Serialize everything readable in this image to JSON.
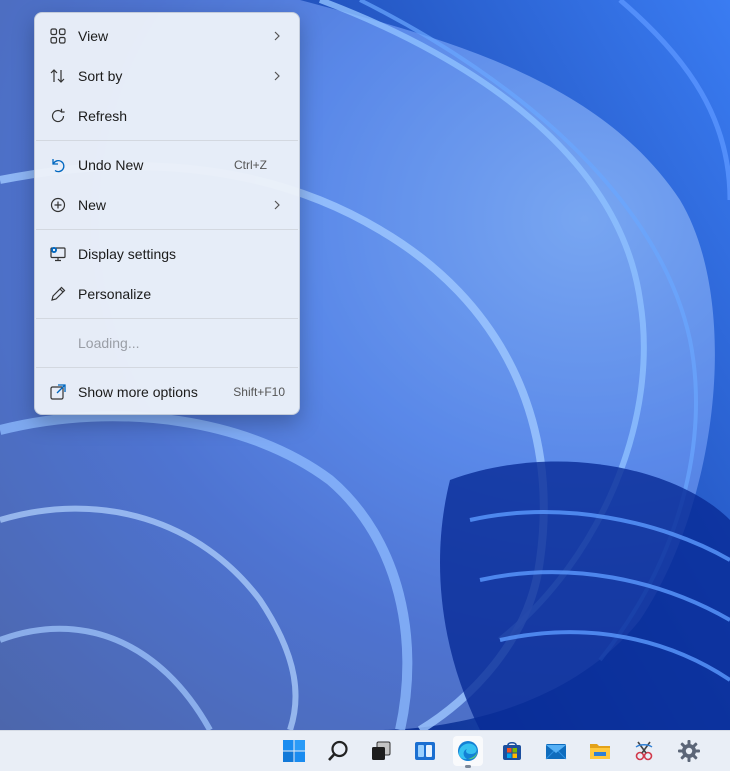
{
  "context_menu": {
    "items": [
      {
        "label": "View",
        "icon": "view-grid-icon",
        "has_submenu": true
      },
      {
        "label": "Sort by",
        "icon": "sort-arrows-icon",
        "has_submenu": true
      },
      {
        "label": "Refresh",
        "icon": "refresh-icon"
      },
      {
        "label": "Undo New",
        "icon": "undo-icon",
        "shortcut": "Ctrl+Z"
      },
      {
        "label": "New",
        "icon": "plus-circle-icon",
        "has_submenu": true
      },
      {
        "label": "Display settings",
        "icon": "display-settings-icon"
      },
      {
        "label": "Personalize",
        "icon": "pen-icon"
      },
      {
        "label": "Loading...",
        "disabled": true
      },
      {
        "label": "Show more options",
        "icon": "expand-icon",
        "shortcut": "Shift+F10"
      }
    ]
  },
  "taskbar": {
    "icons": [
      "start-icon",
      "search-icon",
      "task-view-icon",
      "widgets-icon",
      "edge-icon",
      "store-icon",
      "mail-icon",
      "file-explorer-icon",
      "snipping-tool-icon",
      "settings-icon"
    ],
    "active": "edge-icon"
  },
  "colors": {
    "accent": "#0067c0",
    "menu_bg": "#ecf1f9",
    "wallpaper": "#1f5fe8",
    "taskbar_bg": "#e9eef6"
  }
}
